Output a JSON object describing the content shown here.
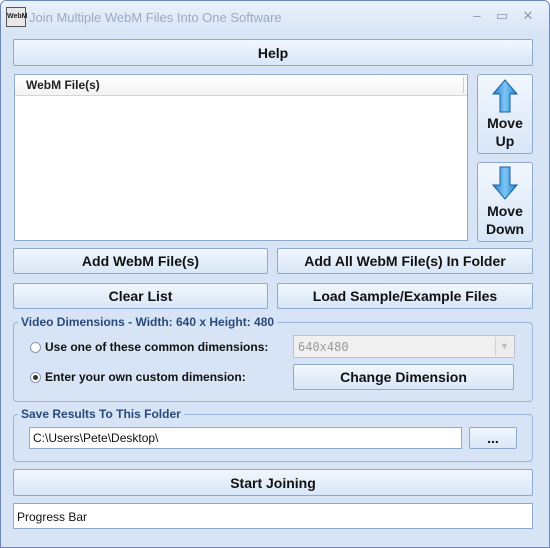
{
  "window": {
    "title": "Join Multiple WebM Files Into One Software",
    "icon_text": "WebM",
    "controls": {
      "close": "✕",
      "minimize": "‒",
      "maximize": "▭"
    }
  },
  "buttons": {
    "help": "Help",
    "move_up_1": "Move",
    "move_up_2": "Up",
    "move_down_1": "Move",
    "move_down_2": "Down",
    "add_files": "Add WebM File(s)",
    "add_folder": "Add All WebM File(s) In Folder",
    "clear_list": "Clear List",
    "load_sample": "Load Sample/Example Files",
    "change_dimension": "Change Dimension",
    "browse": "...",
    "start": "Start Joining"
  },
  "file_list": {
    "column_header": "WebM File(s)",
    "items": []
  },
  "video_dimensions": {
    "group_title": "Video Dimensions -  Width: 640 x  Height: 480",
    "option_common": "Use one of these common dimensions:",
    "option_custom": "Enter your own custom dimension:",
    "selected_option": "custom",
    "common_value": "640x480"
  },
  "save_folder": {
    "group_title": "Save Results To This Folder",
    "path": "C:\\Users\\Pete\\Desktop\\"
  },
  "progress": {
    "label": "Progress Bar"
  }
}
